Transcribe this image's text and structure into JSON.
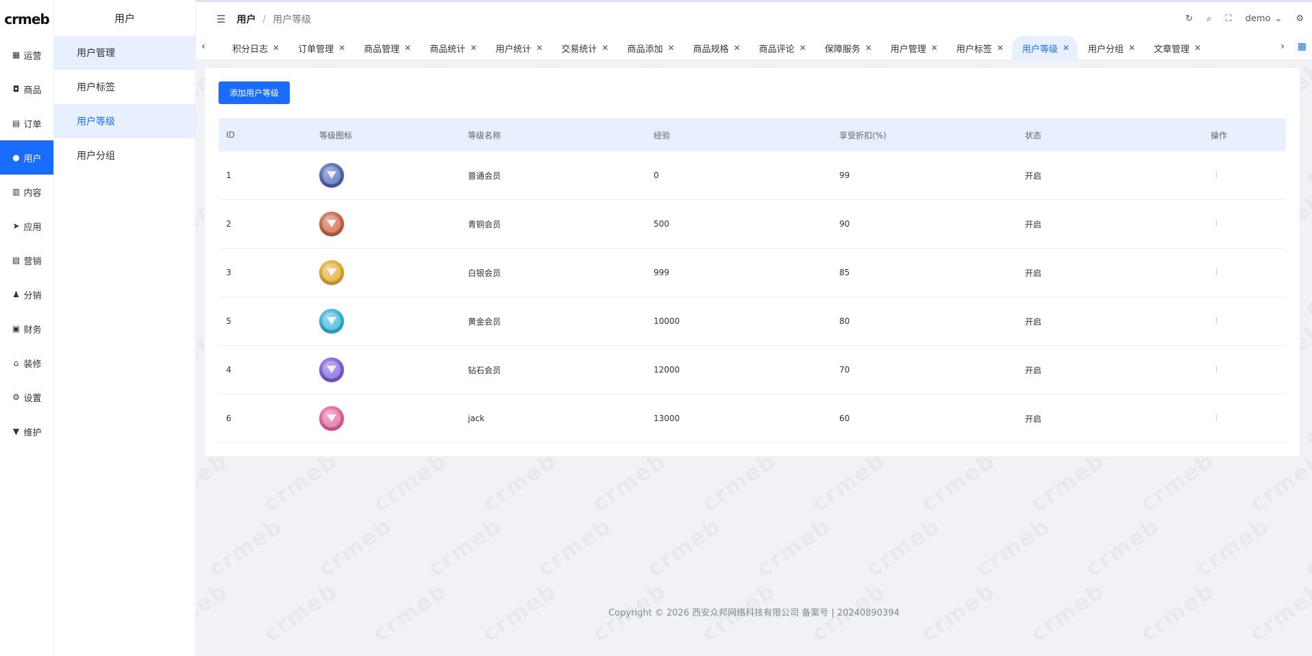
{
  "logo": "crmeb",
  "rail": [
    {
      "label": "运营",
      "icon": "grid-icon"
    },
    {
      "label": "商品",
      "icon": "bag-icon"
    },
    {
      "label": "订单",
      "icon": "clipboard-icon"
    },
    {
      "label": "用户",
      "icon": "user-icon",
      "active": true
    },
    {
      "label": "内容",
      "icon": "book-icon"
    },
    {
      "label": "应用",
      "icon": "send-icon"
    },
    {
      "label": "营销",
      "icon": "chart-icon"
    },
    {
      "label": "分销",
      "icon": "person-icon"
    },
    {
      "label": "财务",
      "icon": "wallet-icon"
    },
    {
      "label": "装修",
      "icon": "home-icon"
    },
    {
      "label": "设置",
      "icon": "gear-icon"
    },
    {
      "label": "维护",
      "icon": "tool-icon"
    }
  ],
  "submenu": {
    "title": "用户",
    "items": [
      "用户管理",
      "用户标签",
      "用户等级",
      "用户分组"
    ]
  },
  "header": {
    "breadcrumb": [
      "用户",
      "用户等级"
    ],
    "username": "demo"
  },
  "tabs": [
    "积分日志",
    "订单管理",
    "商品管理",
    "商品统计",
    "用户统计",
    "交易统计",
    "商品添加",
    "商品规格",
    "商品评论",
    "保障服务",
    "用户管理",
    "用户标签",
    "用户等级",
    "用户分组",
    "文章管理"
  ],
  "active_tab": "用户等级",
  "main": {
    "add_button": "添加用户等级",
    "columns": [
      "ID",
      "等级图标",
      "等级名称",
      "经验",
      "享受折扣(%)",
      "状态",
      "操作"
    ],
    "rows": [
      {
        "id": "1",
        "name": "普通会员",
        "exp": "0",
        "discount": "99",
        "status": "开启",
        "badge_color": "#4a63b3"
      },
      {
        "id": "2",
        "name": "青铜会员",
        "exp": "500",
        "discount": "90",
        "status": "开启",
        "badge_color": "#c9603e"
      },
      {
        "id": "3",
        "name": "白银会员",
        "exp": "999",
        "discount": "85",
        "status": "开启",
        "badge_color": "#e0a92a"
      },
      {
        "id": "5",
        "name": "黄金会员",
        "exp": "10000",
        "discount": "80",
        "status": "开启",
        "badge_color": "#2fb2d6"
      },
      {
        "id": "4",
        "name": "钻石会员",
        "exp": "12000",
        "discount": "70",
        "status": "开启",
        "badge_color": "#7a5bd6"
      },
      {
        "id": "6",
        "name": "jack",
        "exp": "13000",
        "discount": "60",
        "status": "开启",
        "badge_color": "#e0609a"
      }
    ]
  },
  "footer": "Copyright © 2026 西安众邦网络科技有限公司 备案号 | 20240890394",
  "colors": {
    "accent": "#1a6bff",
    "accent_light": "#e8f0ff"
  }
}
